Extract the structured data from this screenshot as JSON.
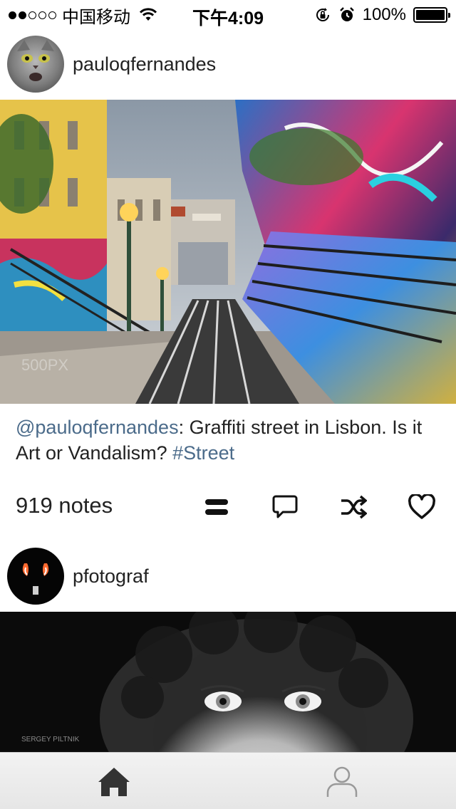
{
  "status_bar": {
    "carrier": "中国移动",
    "time": "下午4:09",
    "battery": "100%",
    "battery_level": 1.0,
    "signal_bars_filled": 2,
    "signal_bars_total": 5
  },
  "posts": [
    {
      "username": "pauloqfernandes",
      "caption": {
        "mention": "@pauloqfernandes",
        "separator": ":",
        "text": " Graffiti street in Lisbon. Is it Art or Vandalism? ",
        "tag": "#Street"
      },
      "notes": "919 notes",
      "actions": [
        "reblog-equals-icon",
        "comment-icon",
        "shuffle-icon",
        "heart-icon"
      ]
    },
    {
      "username": "pfotograf",
      "photo_watermark": "SERGEY PILTNIK"
    }
  ],
  "tab_bar": {
    "items": [
      "home-icon",
      "profile-icon"
    ],
    "active": "home-icon"
  },
  "colors": {
    "link": "#4b6b8a",
    "text": "#222222",
    "tab_icon_active": "#333333",
    "tab_icon_inactive": "#999999"
  }
}
